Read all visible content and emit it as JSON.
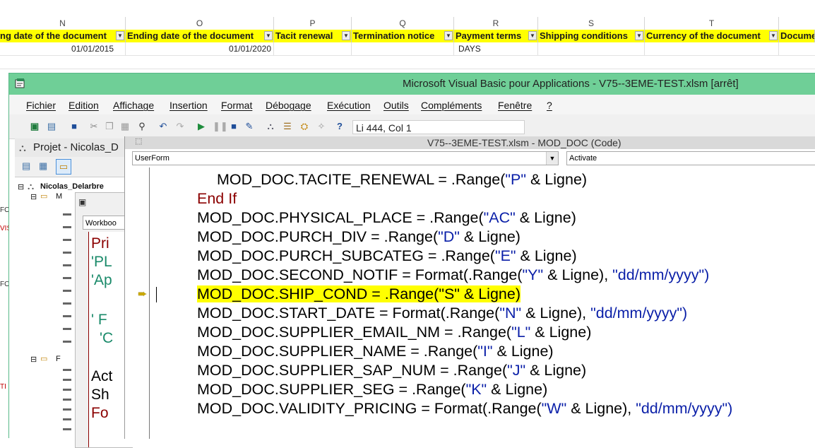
{
  "excel": {
    "columns": [
      {
        "letter": "N",
        "header": "ng date of the document",
        "value": "01/01/2015"
      },
      {
        "letter": "O",
        "header": "Ending date of the document",
        "value": "01/01/2020"
      },
      {
        "letter": "P",
        "header": "Tacit renewal",
        "value": ""
      },
      {
        "letter": "Q",
        "header": "Termination notice",
        "value": ""
      },
      {
        "letter": "R",
        "header": "Payment terms",
        "value": "DAYS"
      },
      {
        "letter": "S",
        "header": "Shipping conditions",
        "value": ""
      },
      {
        "letter": "T",
        "header": "Currency of the document",
        "value": ""
      },
      {
        "letter": "",
        "header": "Docume",
        "value": ""
      }
    ],
    "left_fragments": [
      "FO",
      "VIS",
      "FO",
      "TI"
    ]
  },
  "vbe": {
    "title": "Microsoft Visual Basic pour Applications - V75--3EME-TEST.xlsm [arrêt]",
    "menu": [
      "Fichier",
      "Edition",
      "Affichage",
      "Insertion",
      "Format",
      "Débogage",
      "Exécution",
      "Outils",
      "Compléments",
      "Fenêtre",
      "?"
    ],
    "position": "Li 444, Col 1",
    "project": {
      "title": "Projet - Nicolas_D",
      "root": "Nicolas_Delarbre",
      "node_m": "M",
      "node_f": "F"
    },
    "userform": {
      "tab": "Workboo",
      "lines": [
        "Pri",
        "'PL",
        "'Ap",
        "' F",
        "'C",
        "Act",
        "Sh",
        "Fo"
      ]
    },
    "code_window": {
      "title": "V75--3EME-TEST.xlsm - MOD_DOC (Code)",
      "object_combo": "UserForm",
      "proc_combo": "Activate",
      "lines": [
        {
          "a": "MOD_DOC.TACITE_RENEWAL = .Range(",
          "s": "\"P\"",
          "b": " & Ligne)",
          "c": ""
        },
        {
          "a": "End If",
          "s": "",
          "b": "",
          "c": ""
        },
        {
          "a": "MOD_DOC.PHYSICAL_PLACE = .Range(",
          "s": "\"AC\"",
          "b": " & Ligne)",
          "c": ""
        },
        {
          "a": "MOD_DOC.PURCH_DIV = .Range(",
          "s": "\"D\"",
          "b": " & Ligne)",
          "c": ""
        },
        {
          "a": "MOD_DOC.PURCH_SUBCATEG = .Range(",
          "s": "\"E\"",
          "b": " & Ligne)",
          "c": ""
        },
        {
          "a": "MOD_DOC.SECOND_NOTIF = Format(.Range(",
          "s": "\"Y\"",
          "b": " & Ligne), ",
          "c": "\"dd/mm/yyyy\")"
        },
        {
          "a": "MOD_DOC.SHIP_COND = .Range(",
          "s": "\"S\"",
          "b": " & Ligne)",
          "c": ""
        },
        {
          "a": "MOD_DOC.START_DATE = Format(.Range(",
          "s": "\"N\"",
          "b": " & Ligne), ",
          "c": "\"dd/mm/yyyy\")"
        },
        {
          "a": "MOD_DOC.SUPPLIER_EMAIL_NM = .Range(",
          "s": "\"L\"",
          "b": " & Ligne)",
          "c": ""
        },
        {
          "a": "MOD_DOC.SUPPLIER_NAME = .Range(",
          "s": "\"I\"",
          "b": " & Ligne)",
          "c": ""
        },
        {
          "a": "MOD_DOC.SUPPLIER_SAP_NUM = .Range(",
          "s": "\"J\"",
          "b": " & Ligne)",
          "c": ""
        },
        {
          "a": "MOD_DOC.SUPPLIER_SEG = .Range(",
          "s": "\"K\"",
          "b": " & Ligne)",
          "c": ""
        },
        {
          "a": "MOD_DOC.VALIDITY_PRICING = Format(.Range(",
          "s": "\"W\"",
          "b": " & Ligne), ",
          "c": "\"dd/mm/yyyy\")"
        }
      ],
      "highlight_color": "#ffff00",
      "keyword_color": "#8b0000",
      "string_color": "#0a1fa8"
    }
  }
}
